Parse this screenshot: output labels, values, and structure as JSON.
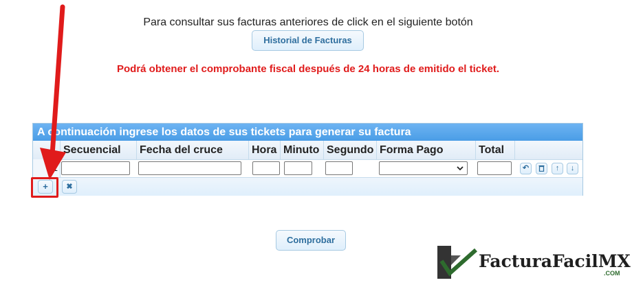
{
  "intro_text": "Para consultar sus facturas anteriores de click en el siguiente botón",
  "history_button": "Historial de Facturas",
  "warning_text": "Podrá obtener el comprobante fiscal después de 24 horas de emitido el ticket.",
  "grid": {
    "caption": "A continuación ingrese los datos de sus tickets para generar su factura",
    "columns": [
      "Secuencial",
      "Fecha del cruce",
      "Hora",
      "Minuto",
      "Segundo",
      "Forma Pago",
      "Total"
    ],
    "rows": [
      {
        "num": "1",
        "secuencial": "",
        "fecha": "",
        "hora": "",
        "minuto": "",
        "segundo": "",
        "forma_pago": "",
        "total": ""
      }
    ],
    "row_actions": [
      "undo-icon",
      "trash-icon",
      "arrow-up-icon",
      "arrow-down-icon"
    ],
    "pager": {
      "add": "+",
      "delete": "✖"
    }
  },
  "check_button": "Comprobar",
  "logo": {
    "name": "FacturaFacilMX",
    "tld": ".COM"
  },
  "colors": {
    "accent": "#4a9de6",
    "warning": "#e01b1b",
    "button_text": "#2e6e9e",
    "logo_green": "#2e6b2e"
  }
}
